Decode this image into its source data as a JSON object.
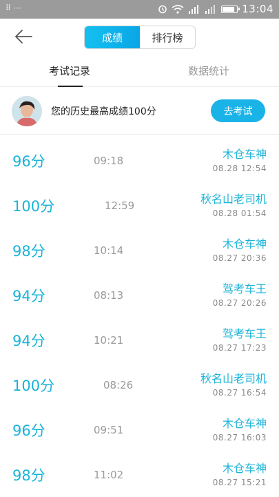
{
  "status_bar": {
    "left_icons": "⠿ ⋯",
    "time": "13:04",
    "battery_level": 0.85
  },
  "header": {
    "seg_tabs": [
      "成绩",
      "排行榜"
    ],
    "active_seg": 0
  },
  "tabs": {
    "items": [
      "考试记录",
      "数据统计"
    ],
    "active": 0
  },
  "best": {
    "text": "您的历史最高成绩100分",
    "button": "去考试"
  },
  "records": [
    {
      "score": "96分",
      "duration": "09:18",
      "name": "木仓车神",
      "date": "08.28  12:54"
    },
    {
      "score": "100分",
      "duration": "12:59",
      "name": "秋名山老司机",
      "date": "08.28  01:54"
    },
    {
      "score": "98分",
      "duration": "10:14",
      "name": "木仓车神",
      "date": "08.27  20:36"
    },
    {
      "score": "94分",
      "duration": "08:13",
      "name": "驾考车王",
      "date": "08.27  20:26"
    },
    {
      "score": "94分",
      "duration": "10:21",
      "name": "驾考车王",
      "date": "08.27  17:23"
    },
    {
      "score": "100分",
      "duration": "08:26",
      "name": "秋名山老司机",
      "date": "08.27  16:54"
    },
    {
      "score": "96分",
      "duration": "09:51",
      "name": "木仓车神",
      "date": "08.27  16:03"
    },
    {
      "score": "98分",
      "duration": "11:02",
      "name": "木仓车神",
      "date": "08.27  15:21"
    }
  ]
}
